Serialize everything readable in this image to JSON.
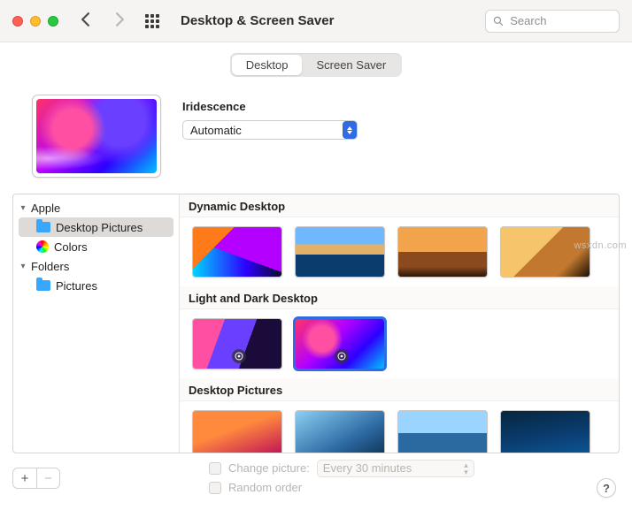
{
  "window": {
    "title": "Desktop & Screen Saver"
  },
  "search": {
    "placeholder": "Search",
    "value": ""
  },
  "tabs": {
    "desktop": "Desktop",
    "screensaver": "Screen Saver",
    "active": "desktop"
  },
  "preview": {
    "name": "Iridescence",
    "mode_select": {
      "value": "Automatic"
    }
  },
  "sidebar": {
    "groups": [
      {
        "label": "Apple",
        "expanded": true,
        "items": [
          {
            "label": "Desktop Pictures",
            "icon": "folder",
            "selected": true
          },
          {
            "label": "Colors",
            "icon": "color-wheel",
            "selected": false
          }
        ]
      },
      {
        "label": "Folders",
        "expanded": true,
        "items": [
          {
            "label": "Pictures",
            "icon": "folder",
            "selected": false
          }
        ]
      }
    ]
  },
  "sections": {
    "dynamic": {
      "title": "Dynamic Desktop"
    },
    "lightdark": {
      "title": "Light and Dark Desktop"
    },
    "pictures": {
      "title": "Desktop Pictures"
    }
  },
  "footer": {
    "change_picture_label": "Change picture:",
    "interval_value": "Every 30 minutes",
    "random_order_label": "Random order",
    "change_picture_checked": false,
    "random_order_checked": false
  },
  "watermark": "wsxdn.com"
}
